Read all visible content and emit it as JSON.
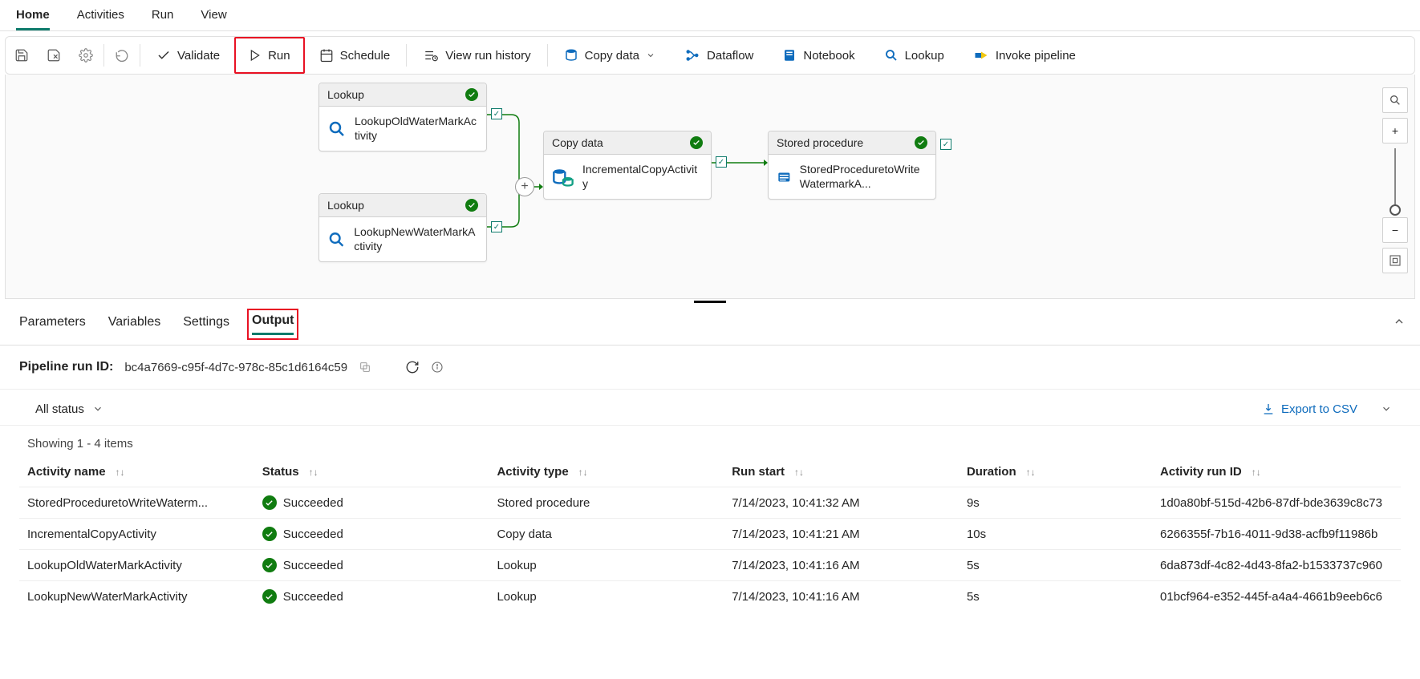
{
  "ribbon": {
    "tabs": [
      "Home",
      "Activities",
      "Run",
      "View"
    ],
    "active": 0
  },
  "toolbar": {
    "validate": "Validate",
    "run": "Run",
    "schedule": "Schedule",
    "history": "View run history",
    "copydata": "Copy data",
    "dataflow": "Dataflow",
    "notebook": "Notebook",
    "lookup": "Lookup",
    "invoke": "Invoke pipeline"
  },
  "activities": {
    "a1_type": "Lookup",
    "a1_name": "LookupOldWaterMarkActivity",
    "a2_type": "Lookup",
    "a2_name": "LookupNewWaterMarkActivity",
    "a3_type": "Copy data",
    "a3_name": "IncrementalCopyActivity",
    "a4_type": "Stored procedure",
    "a4_name": "StoredProceduretoWriteWatermarkA..."
  },
  "panel": {
    "tabs": [
      "Parameters",
      "Variables",
      "Settings",
      "Output"
    ],
    "active": 3
  },
  "runid": {
    "label": "Pipeline run ID:",
    "value": "bc4a7669-c95f-4d7c-978c-85c1d6164c59"
  },
  "filter": {
    "status": "All status",
    "export": "Export to CSV"
  },
  "showing": "Showing 1 - 4 items",
  "cols": {
    "c1": "Activity name",
    "c2": "Status",
    "c3": "Activity type",
    "c4": "Run start",
    "c5": "Duration",
    "c6": "Activity run ID"
  },
  "rows": [
    {
      "name": "StoredProceduretoWriteWaterm...",
      "status": "Succeeded",
      "type": "Stored procedure",
      "start": "7/14/2023, 10:41:32 AM",
      "dur": "9s",
      "id": "1d0a80bf-515d-42b6-87df-bde3639c8c73"
    },
    {
      "name": "IncrementalCopyActivity",
      "status": "Succeeded",
      "type": "Copy data",
      "start": "7/14/2023, 10:41:21 AM",
      "dur": "10s",
      "id": "6266355f-7b16-4011-9d38-acfb9f11986b"
    },
    {
      "name": "LookupOldWaterMarkActivity",
      "status": "Succeeded",
      "type": "Lookup",
      "start": "7/14/2023, 10:41:16 AM",
      "dur": "5s",
      "id": "6da873df-4c82-4d43-8fa2-b1533737c960"
    },
    {
      "name": "LookupNewWaterMarkActivity",
      "status": "Succeeded",
      "type": "Lookup",
      "start": "7/14/2023, 10:41:16 AM",
      "dur": "5s",
      "id": "01bcf964-e352-445f-a4a4-4661b9eeb6c6"
    }
  ]
}
